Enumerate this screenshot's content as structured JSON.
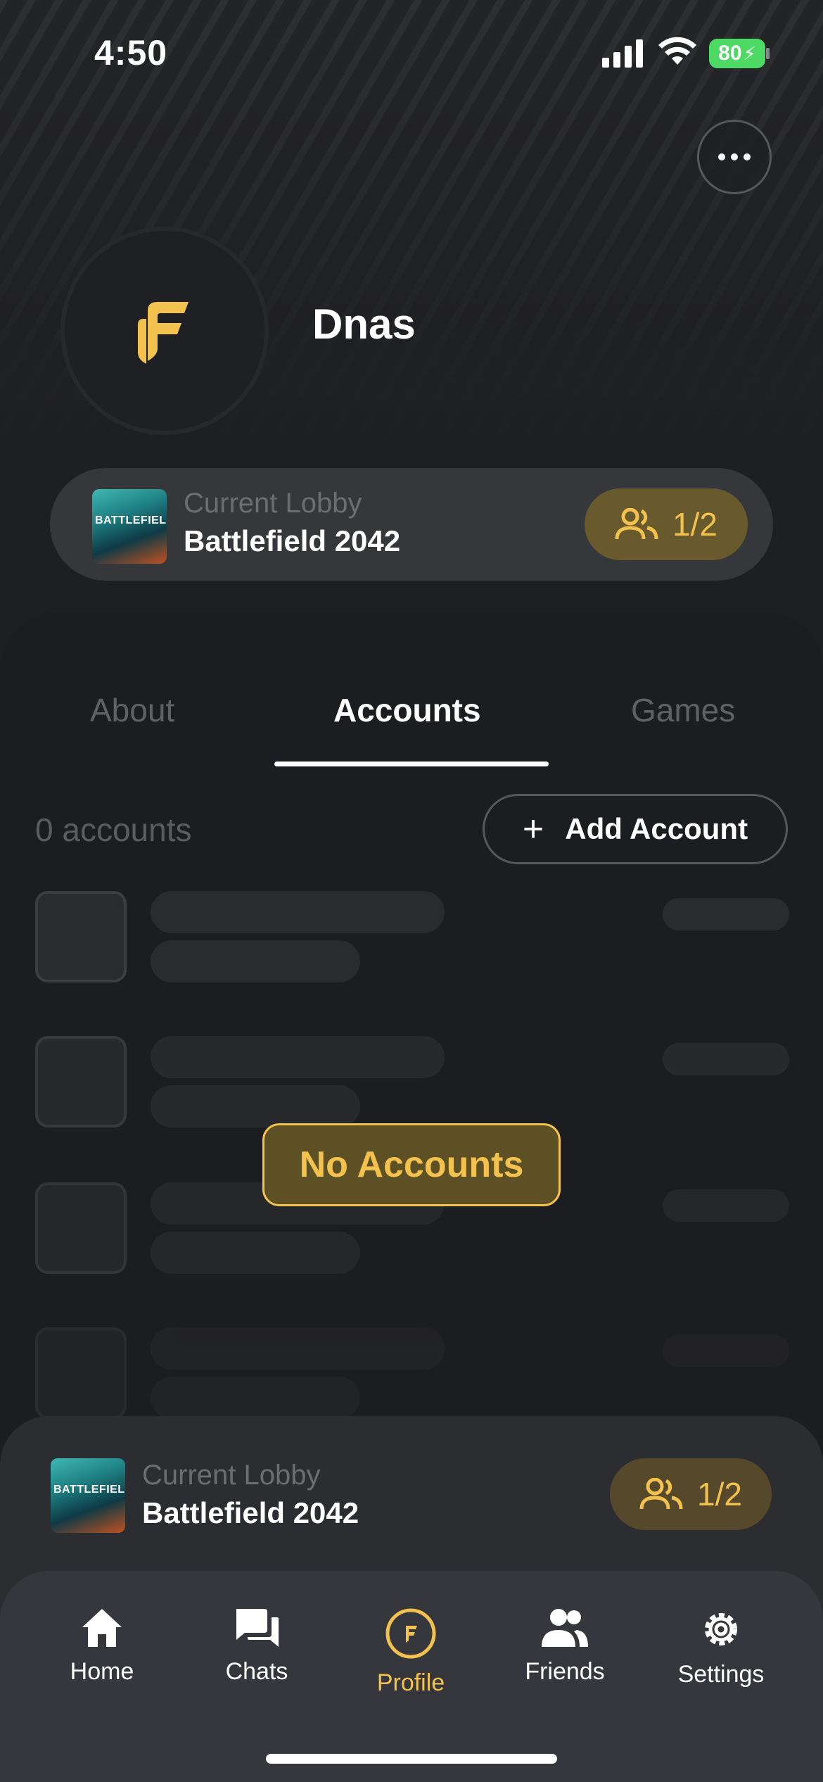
{
  "status_bar": {
    "time": "4:50",
    "battery": "80"
  },
  "profile": {
    "username": "Dnas"
  },
  "current_lobby": {
    "label": "Current Lobby",
    "game": "Battlefield 2042",
    "thumb_text": "BATTLEFIELD",
    "players": "1/2"
  },
  "tabs": [
    {
      "label": "About"
    },
    {
      "label": "Accounts"
    },
    {
      "label": "Games"
    }
  ],
  "accounts": {
    "count_label": "0 accounts",
    "add_label": "Add Account",
    "empty_label": "No Accounts"
  },
  "bottom_lobby": {
    "label": "Current Lobby",
    "game": "Battlefield 2042",
    "thumb_text": "BATTLEFIELD",
    "players": "1/2"
  },
  "nav": {
    "home": "Home",
    "chats": "Chats",
    "profile": "Profile",
    "friends": "Friends",
    "settings": "Settings"
  },
  "colors": {
    "accent": "#f2c14e",
    "background": "#1e1f22"
  }
}
